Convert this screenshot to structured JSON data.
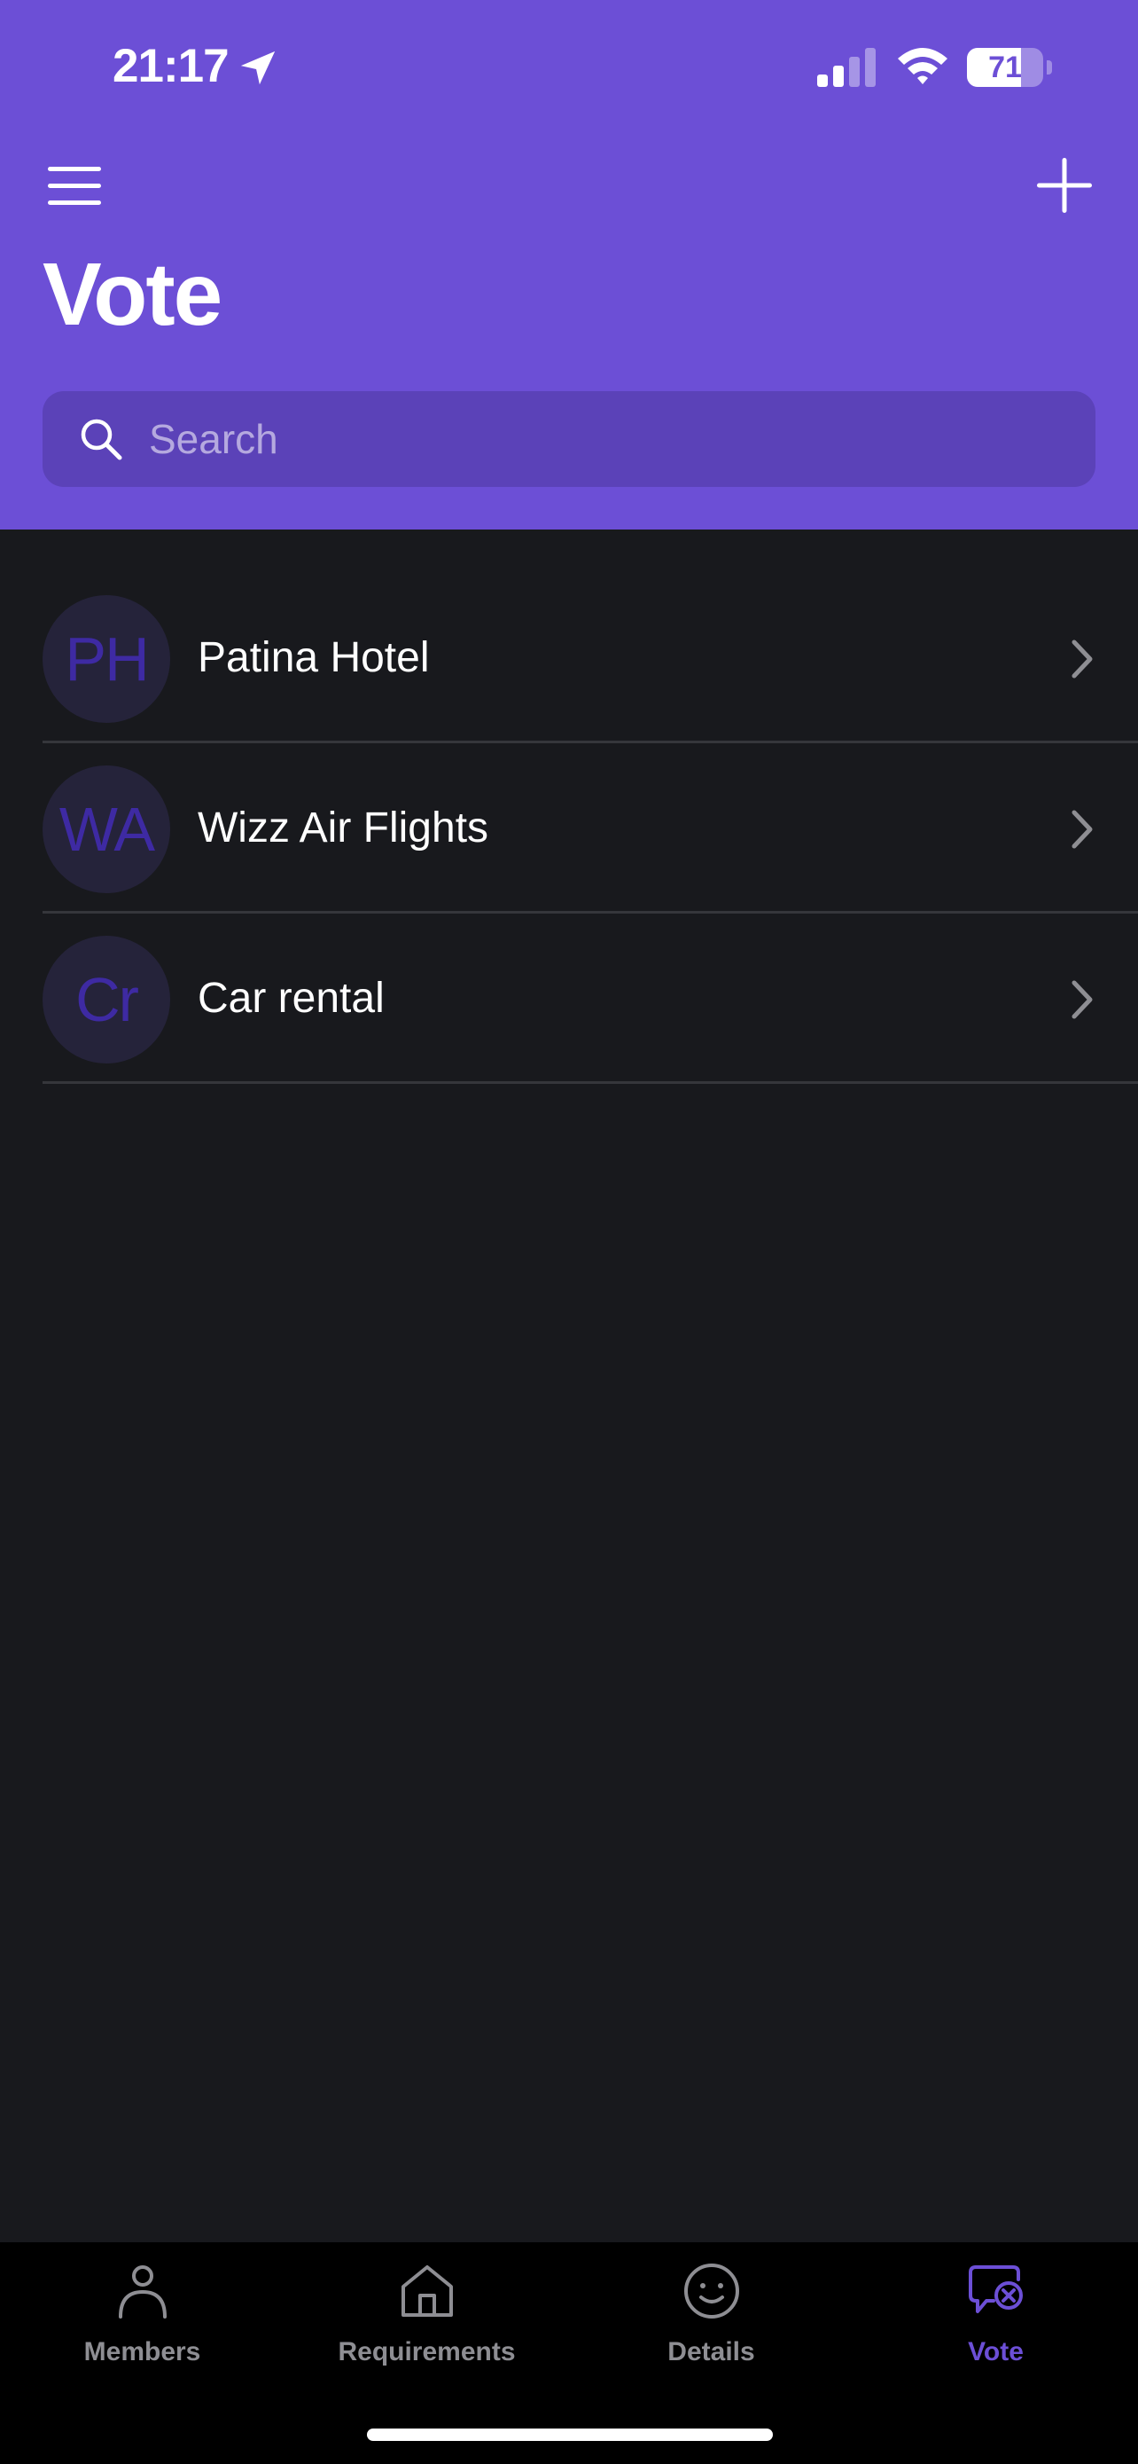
{
  "status_bar": {
    "time": "21:17",
    "battery": "71",
    "battery_level": 0.71
  },
  "header": {
    "title": "Vote",
    "menu_icon": "hamburger-menu-icon",
    "add_icon": "plus-icon"
  },
  "search": {
    "placeholder": "Search",
    "value": ""
  },
  "vote_items": [
    {
      "initials": "PH",
      "label": "Patina Hotel"
    },
    {
      "initials": "WA",
      "label": "Wizz Air Flights"
    },
    {
      "initials": "Cr",
      "label": "Car rental"
    }
  ],
  "tab_bar": {
    "tabs": [
      {
        "label": "Members",
        "icon": "person-icon",
        "active": false
      },
      {
        "label": "Requirements",
        "icon": "house-icon",
        "active": false
      },
      {
        "label": "Details",
        "icon": "smiley-icon",
        "active": false
      },
      {
        "label": "Vote",
        "icon": "vote-bubble-icon",
        "active": true
      }
    ]
  },
  "colors": {
    "accent": "#6c4fd6",
    "background": "#18191d",
    "search_background": "#5b42b8",
    "avatar_background": "#25233a",
    "avatar_text": "#3e2aa3",
    "tab_inactive": "#8e8e93"
  }
}
